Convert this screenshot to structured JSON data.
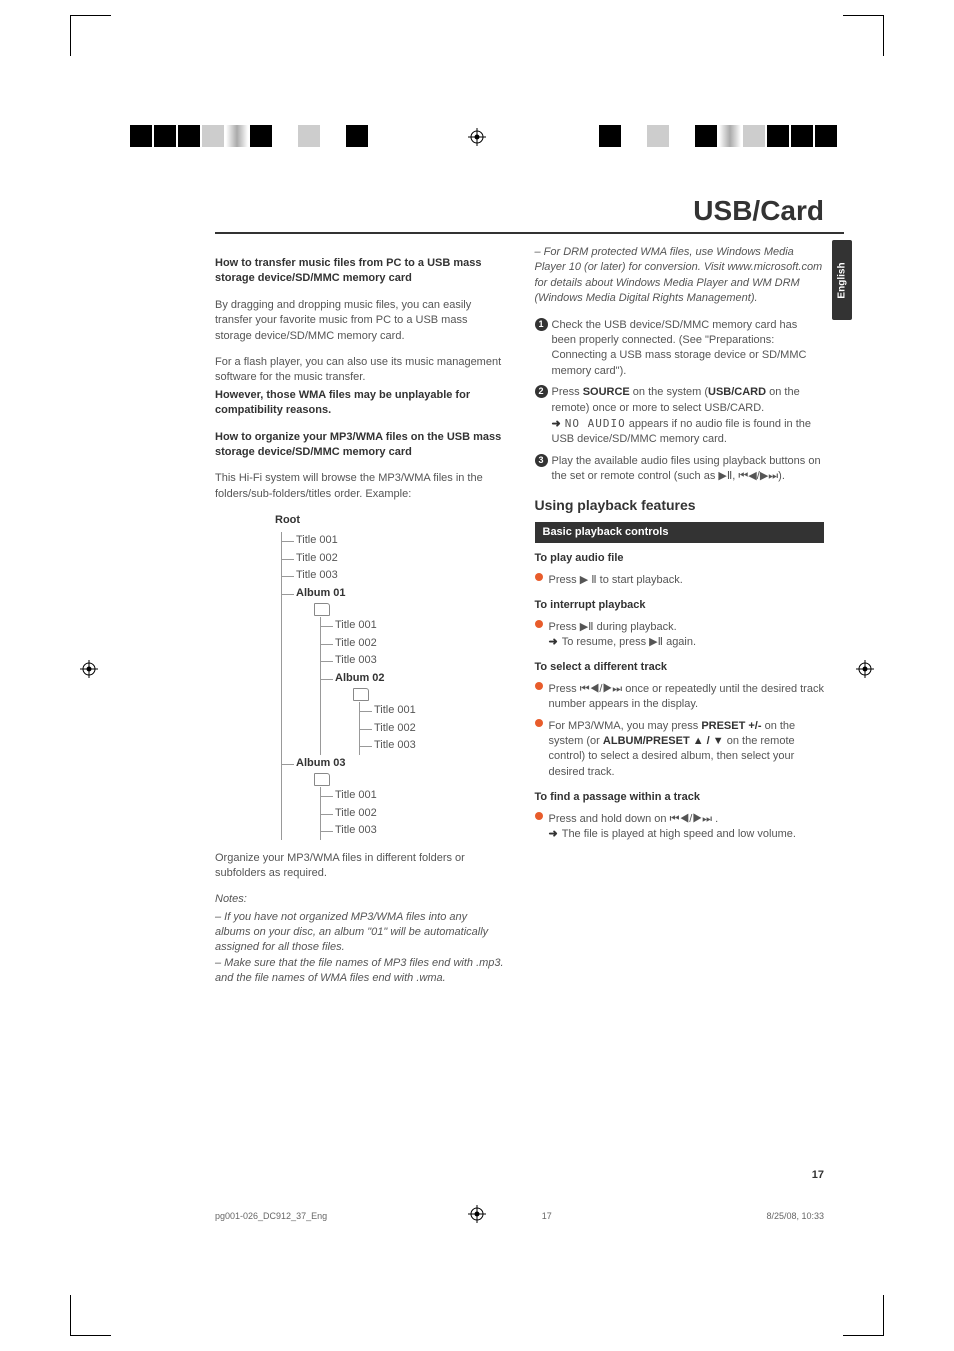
{
  "lang_tab": "English",
  "page_title": "USB/Card",
  "page_number": "17",
  "left": {
    "h1": "How to transfer music files from PC to a USB mass storage device/SD/MMC memory card",
    "p1": "By dragging and dropping music files, you can easily transfer your favorite music from PC to a USB mass storage device/SD/MMC memory card.",
    "p2": "For a flash player, you can also use its music management software for the music transfer.",
    "p3": "However, those WMA files may be unplayable for compatibility reasons.",
    "h2": "How to organize your MP3/WMA files on the USB mass storage device/SD/MMC memory card",
    "p4": "This Hi-Fi system will browse the MP3/WMA files in the folders/sub-folders/titles order. Example:",
    "tree": {
      "root": "Root",
      "titles": [
        "Title 001",
        "Title 002",
        "Title 003"
      ],
      "albums": [
        {
          "name": "Album 01",
          "titles": [
            "Title 001",
            "Title 002",
            "Title 003"
          ]
        },
        {
          "name": "Album 02",
          "titles": [
            "Title 001",
            "Title 002",
            "Title 003"
          ]
        },
        {
          "name": "Album 03",
          "titles": [
            "Title 001",
            "Title 002",
            "Title 003"
          ]
        }
      ]
    },
    "p5": "Organize your MP3/WMA files in different folders or subfolders as required.",
    "notes_h": "Notes:",
    "note1": "– If you have not organized MP3/WMA files into any albums on your disc, an album \"01\" will be automatically assigned for all those files.",
    "note2": "– Make sure that the file names of MP3 files end with .mp3. and the file names of WMA files end with .wma.",
    "note3": "– For DRM protected WMA files, use Windows Media Player 10 (or later) for conversion. Visit www.microsoft.com for details about Windows Media Player and WM DRM (Windows Media Digital Rights Management)."
  },
  "right": {
    "step1": "Check the USB device/SD/MMC memory card has been properly connected. (See \"Preparations: Connecting a USB mass storage device or SD/MMC memory card\").",
    "step2a": "Press ",
    "step2b": "SOURCE",
    "step2c": " on the system (",
    "step2d": "USB/CARD",
    "step2e": " on the remote) once or more to select USB/CARD.",
    "step2_res_a": "NO AUDIO",
    "step2_res_b": " appears if no audio file is found in the USB device/SD/MMC memory card.",
    "step3": "Play the available audio files using playback buttons on the set or remote control (such as ",
    "step3_sym": "▶Ⅱ, ⏮◀/▶⏭).",
    "sec": "Using playback features",
    "sub1": "Basic playback controls",
    "h_play": "To play audio file",
    "play_a": "Press  ",
    "play_sym": "▶ Ⅱ",
    "play_b": "  to start playback.",
    "h_int": "To interrupt playback",
    "int_a": "Press ",
    "int_sym": "▶Ⅱ",
    "int_b": " during playback.",
    "int_res_a": "To resume, press ",
    "int_res_sym": "▶Ⅱ",
    "int_res_b": " again.",
    "h_sel": "To select a different track",
    "sel_a": "Press ",
    "sel_sym": "⏮◀/▶⏭",
    "sel_b": " once or repeatedly until the desired track number appears in the display.",
    "sel2_a": "For MP3/WMA, you may press ",
    "sel2_b": "PRESET +/-",
    "sel2_c": " on the system (or ",
    "sel2_d": "ALBUM/PRESET ▲ / ▼",
    "sel2_e": " on the remote control) to select a desired album, then select your desired track.",
    "h_find": "To find a passage within a track",
    "find_a": "Press and hold down on ",
    "find_sym": "⏮◀/▶⏭ .",
    "find_res": "The file is played at high speed and low volume."
  },
  "footer": {
    "left": "pg001-026_DC912_37_Eng",
    "mid": "17",
    "right": "8/25/08, 10:33"
  }
}
